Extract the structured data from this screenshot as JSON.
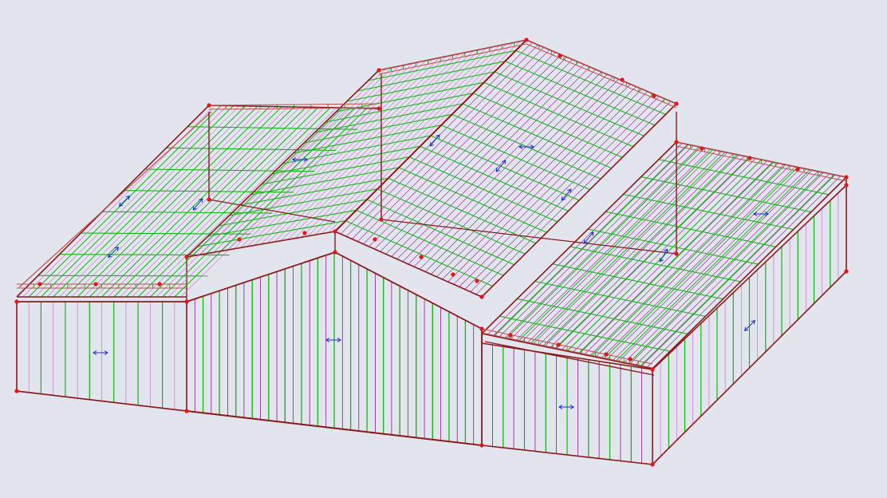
{
  "viewport": {
    "background": "#e2e4ee"
  },
  "model": {
    "colors": {
      "frame": "#8c1a1a",
      "frame_light": "#c05050",
      "joint": "#e01818",
      "purlin": "#14b814",
      "sheet": "#8a1d8a",
      "sheet_light": "#c27ac2",
      "arrow": "#1a2ad8"
    },
    "icons": [
      "member-direction-arrow-icon",
      "node-joint-icon"
    ]
  }
}
